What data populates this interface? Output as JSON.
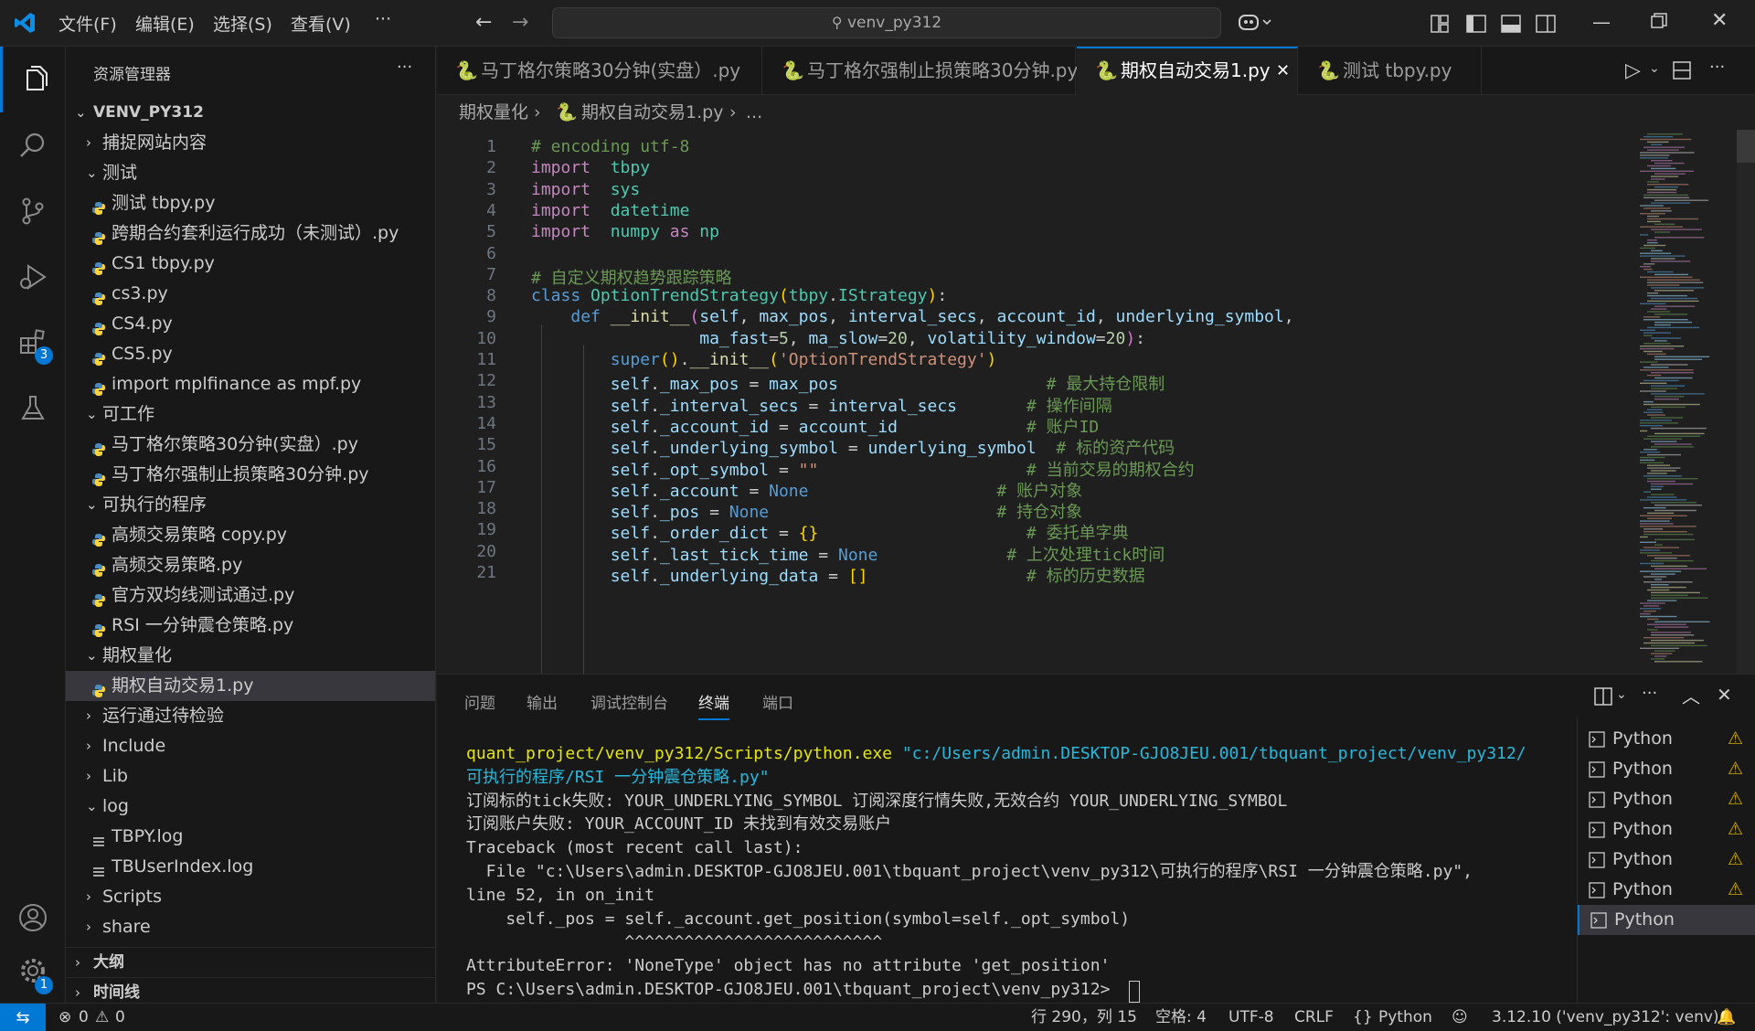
{
  "title_bar": {
    "menus": [
      "文件(F)",
      "编辑(E)",
      "选择(S)",
      "查看(V)",
      "···"
    ],
    "search_text": "venv_py312"
  },
  "activity_bar": {
    "items": [
      "explorer-icon",
      "search-icon",
      "source-control-icon",
      "run-debug-icon",
      "extensions-icon",
      "testing-icon"
    ],
    "extensions_badge": "3",
    "manage_badge": "1"
  },
  "sidebar": {
    "title": "资源管理器",
    "more": "···",
    "root": "VENV_PY312",
    "tree": [
      {
        "label": "捕捉网站内容",
        "type": "folder",
        "open": false,
        "depth": 1
      },
      {
        "label": "测试",
        "type": "folder",
        "open": true,
        "depth": 1
      },
      {
        "label": "测试 tbpy.py",
        "type": "py",
        "depth": 2
      },
      {
        "label": "跨期合约套利运行成功（未测试）.py",
        "type": "py",
        "depth": 2
      },
      {
        "label": "CS1 tbpy.py",
        "type": "py",
        "depth": 2
      },
      {
        "label": "cs3.py",
        "type": "py",
        "depth": 2
      },
      {
        "label": "CS4.py",
        "type": "py",
        "depth": 2
      },
      {
        "label": "CS5.py",
        "type": "py",
        "depth": 2
      },
      {
        "label": "import mplfinance as mpf.py",
        "type": "py",
        "depth": 2
      },
      {
        "label": "可工作",
        "type": "folder",
        "open": true,
        "depth": 1
      },
      {
        "label": "马丁格尔策略30分钟(实盘）.py",
        "type": "py",
        "depth": 2
      },
      {
        "label": "马丁格尔强制止损策略30分钟.py",
        "type": "py",
        "depth": 2
      },
      {
        "label": "可执行的程序",
        "type": "folder",
        "open": true,
        "depth": 1
      },
      {
        "label": "高频交易策略 copy.py",
        "type": "py",
        "depth": 2
      },
      {
        "label": "高频交易策略.py",
        "type": "py",
        "depth": 2
      },
      {
        "label": "官方双均线测试通过.py",
        "type": "py",
        "depth": 2
      },
      {
        "label": "RSI 一分钟震仓策略.py",
        "type": "py",
        "depth": 2
      },
      {
        "label": "期权量化",
        "type": "folder",
        "open": true,
        "depth": 1
      },
      {
        "label": "期权自动交易1.py",
        "type": "py",
        "depth": 2,
        "selected": true
      },
      {
        "label": "运行通过待检验",
        "type": "folder",
        "open": false,
        "depth": 1
      },
      {
        "label": "Include",
        "type": "folder",
        "open": false,
        "depth": 1
      },
      {
        "label": "Lib",
        "type": "folder",
        "open": false,
        "depth": 1
      },
      {
        "label": "log",
        "type": "folder",
        "open": true,
        "depth": 1
      },
      {
        "label": "TBPY.log",
        "type": "log",
        "depth": 2
      },
      {
        "label": "TBUserIndex.log",
        "type": "log",
        "depth": 2
      },
      {
        "label": "Scripts",
        "type": "folder",
        "open": false,
        "depth": 1
      },
      {
        "label": "share",
        "type": "folder",
        "open": false,
        "depth": 1
      }
    ],
    "outline": "大纲",
    "timeline": "时间线"
  },
  "tabs": [
    {
      "label": "马丁格尔策略30分钟(实盘）.py",
      "active": false
    },
    {
      "label": "马丁格尔强制止损策略30分钟.py",
      "active": false
    },
    {
      "label": "期权自动交易1.py",
      "active": true
    },
    {
      "label": "测试 tbpy.py",
      "active": false
    }
  ],
  "breadcrumb": {
    "folder": "期权量化",
    "file": "期权自动交易1.py",
    "more": "..."
  },
  "code_lines": [
    [
      [
        "cm",
        "# encoding utf-8"
      ]
    ],
    [
      [
        "kw",
        "import"
      ],
      [
        "",
        "  "
      ],
      [
        "cls",
        "tbpy"
      ]
    ],
    [
      [
        "kw",
        "import"
      ],
      [
        "",
        "  "
      ],
      [
        "cls",
        "sys"
      ]
    ],
    [
      [
        "kw",
        "import"
      ],
      [
        "",
        "  "
      ],
      [
        "cls",
        "datetime"
      ]
    ],
    [
      [
        "kw",
        "import"
      ],
      [
        "",
        "  "
      ],
      [
        "cls",
        "numpy"
      ],
      [
        "",
        " "
      ],
      [
        "kw",
        "as"
      ],
      [
        "",
        " "
      ],
      [
        "cls",
        "np"
      ]
    ],
    [],
    [
      [
        "cm",
        "# 自定义期权趋势跟踪策略"
      ]
    ],
    [
      [
        "ctl",
        "class"
      ],
      [
        "",
        " "
      ],
      [
        "cls",
        "OptionTrendStrategy"
      ],
      [
        "br",
        "("
      ],
      [
        "cls",
        "tbpy"
      ],
      [
        "",
        ". "
      ],
      [
        "cls",
        "IStrategy"
      ],
      [
        "br",
        ")"
      ],
      [
        "",
        ":"
      ]
    ],
    [
      [
        "",
        "    "
      ],
      [
        "ctl",
        "def"
      ],
      [
        "",
        " "
      ],
      [
        "fn",
        "__init__"
      ],
      [
        "br2",
        "("
      ],
      [
        "var",
        "self"
      ],
      [
        "",
        ", "
      ],
      [
        "var",
        "max_pos"
      ],
      [
        "",
        ", "
      ],
      [
        "var",
        "interval_secs"
      ],
      [
        "",
        ", "
      ],
      [
        "var",
        "account_id"
      ],
      [
        "",
        ", "
      ],
      [
        "var",
        "underlying_symbol"
      ],
      [
        "",
        ","
      ]
    ],
    [
      [
        "",
        "                 "
      ],
      [
        "var",
        "ma_fast"
      ],
      [
        "",
        "="
      ],
      [
        "num",
        "5"
      ],
      [
        "",
        ", "
      ],
      [
        "var",
        "ma_slow"
      ],
      [
        "",
        "="
      ],
      [
        "num",
        "20"
      ],
      [
        "",
        ", "
      ],
      [
        "var",
        "volatility_window"
      ],
      [
        "",
        "="
      ],
      [
        "num",
        "20"
      ],
      [
        "br2",
        ")"
      ],
      [
        "",
        ":"
      ]
    ],
    [
      [
        "",
        "        "
      ],
      [
        "ctl",
        "super"
      ],
      [
        "br",
        "()"
      ],
      [
        "",
        "."
      ],
      [
        "fn",
        "__init__"
      ],
      [
        "br",
        "("
      ],
      [
        "str",
        "'OptionTrendStrategy'"
      ],
      [
        "br",
        ")"
      ]
    ],
    [
      [
        "",
        "        "
      ],
      [
        "var",
        "self"
      ],
      [
        "",
        "."
      ],
      [
        "var",
        "_max_pos"
      ],
      [
        "",
        " = "
      ],
      [
        "var",
        "max_pos"
      ],
      [
        "",
        "                     "
      ],
      [
        "cm",
        "# 最大持仓限制"
      ]
    ],
    [
      [
        "",
        "        "
      ],
      [
        "var",
        "self"
      ],
      [
        "",
        "."
      ],
      [
        "var",
        "_interval_secs"
      ],
      [
        "",
        " = "
      ],
      [
        "var",
        "interval_secs"
      ],
      [
        "",
        "       "
      ],
      [
        "cm",
        "# 操作间隔"
      ]
    ],
    [
      [
        "",
        "        "
      ],
      [
        "var",
        "self"
      ],
      [
        "",
        "."
      ],
      [
        "var",
        "_account_id"
      ],
      [
        "",
        " = "
      ],
      [
        "var",
        "account_id"
      ],
      [
        "",
        "             "
      ],
      [
        "cm",
        "# 账户ID"
      ]
    ],
    [
      [
        "",
        "        "
      ],
      [
        "var",
        "self"
      ],
      [
        "",
        "."
      ],
      [
        "var",
        "_underlying_symbol"
      ],
      [
        "",
        " = "
      ],
      [
        "var",
        "underlying_symbol"
      ],
      [
        "",
        "  "
      ],
      [
        "cm",
        "# 标的资产代码"
      ]
    ],
    [
      [
        "",
        "        "
      ],
      [
        "var",
        "self"
      ],
      [
        "",
        "."
      ],
      [
        "var",
        "_opt_symbol"
      ],
      [
        "",
        " = "
      ],
      [
        "str",
        "\"\""
      ],
      [
        "",
        "                     "
      ],
      [
        "cm",
        "# 当前交易的期权合约"
      ]
    ],
    [
      [
        "",
        "        "
      ],
      [
        "var",
        "self"
      ],
      [
        "",
        "."
      ],
      [
        "var",
        "_account"
      ],
      [
        "",
        " = "
      ],
      [
        "ctl",
        "None"
      ],
      [
        "",
        "                   "
      ],
      [
        "cm",
        "# 账户对象"
      ]
    ],
    [
      [
        "",
        "        "
      ],
      [
        "var",
        "self"
      ],
      [
        "",
        "."
      ],
      [
        "var",
        "_pos"
      ],
      [
        "",
        " = "
      ],
      [
        "ctl",
        "None"
      ],
      [
        "",
        "                       "
      ],
      [
        "cm",
        "# 持仓对象"
      ]
    ],
    [
      [
        "",
        "        "
      ],
      [
        "var",
        "self"
      ],
      [
        "",
        "."
      ],
      [
        "var",
        "_order_dict"
      ],
      [
        "",
        " = "
      ],
      [
        "br",
        "{}"
      ],
      [
        "",
        "                     "
      ],
      [
        "cm",
        "# 委托单字典"
      ]
    ],
    [
      [
        "",
        "        "
      ],
      [
        "var",
        "self"
      ],
      [
        "",
        "."
      ],
      [
        "var",
        "_last_tick_time"
      ],
      [
        "",
        " = "
      ],
      [
        "ctl",
        "None"
      ],
      [
        "",
        "             "
      ],
      [
        "cm",
        "# 上次处理tick时间"
      ]
    ],
    [
      [
        "",
        "        "
      ],
      [
        "var",
        "self"
      ],
      [
        "",
        "."
      ],
      [
        "var",
        "_underlying_data"
      ],
      [
        "",
        " = "
      ],
      [
        "br",
        "[]"
      ],
      [
        "",
        "                "
      ],
      [
        "cm",
        "# 标的历史数据"
      ]
    ]
  ],
  "panel": {
    "tabs": [
      "问题",
      "输出",
      "调试控制台",
      "终端",
      "端口"
    ],
    "active_tab": "终端",
    "terminal_lines": [
      [
        [
          "t-yellow",
          "quant_project/venv_py312/Scripts/python.exe"
        ],
        [
          "",
          " "
        ],
        [
          "t-cyan",
          "\"c:/Users/admin.DESKTOP-GJO8JEU.001/tbquant_project/venv_py312/"
        ]
      ],
      [
        [
          "t-cyan",
          "可执行的程序/RSI 一分钟震仓策略.py\""
        ]
      ],
      [
        [
          "",
          "订阅标的tick失败: YOUR_UNDERLYING_SYMBOL 订阅深度行情失败,无效合约 YOUR_UNDERLYING_SYMBOL"
        ]
      ],
      [
        [
          "",
          "订阅账户失败: YOUR_ACCOUNT_ID 未找到有效交易账户"
        ]
      ],
      [
        [
          "",
          "Traceback (most recent call last):"
        ]
      ],
      [
        [
          "",
          "  File \"c:\\Users\\admin.DESKTOP-GJO8JEU.001\\tbquant_project\\venv_py312\\可执行的程序\\RSI 一分钟震仓策略.py\","
        ]
      ],
      [
        [
          "",
          "line 52, in on_init"
        ]
      ],
      [
        [
          "",
          "    self._pos = self._account.get_position(symbol=self._opt_symbol)"
        ]
      ],
      [
        [
          "",
          "                ^^^^^^^^^^^^^^^^^^^^^^^^^^"
        ]
      ],
      [
        [
          "",
          "AttributeError: 'NoneType' object has no attribute 'get_position'"
        ]
      ],
      [
        [
          "",
          "PS C:\\Users\\admin.DESKTOP-GJO8JEU.001\\tbquant_project\\venv_py312> "
        ]
      ]
    ],
    "terminals": [
      {
        "label": "Python",
        "warn": true
      },
      {
        "label": "Python",
        "warn": true
      },
      {
        "label": "Python",
        "warn": true
      },
      {
        "label": "Python",
        "warn": true
      },
      {
        "label": "Python",
        "warn": true
      },
      {
        "label": "Python",
        "warn": true
      },
      {
        "label": "Python",
        "warn": false,
        "selected": true
      }
    ]
  },
  "status_bar": {
    "errors": "0",
    "warnings": "0",
    "cursor": "行 290，列 15",
    "spaces": "空格: 4",
    "encoding": "UTF-8",
    "eol": "CRLF",
    "language": "Python",
    "interpreter": "3.12.10 ('venv_py312': venv)"
  },
  "colors": {
    "accent": "#0078d4",
    "bg": "#1f1f1f",
    "sidebar": "#181818"
  }
}
